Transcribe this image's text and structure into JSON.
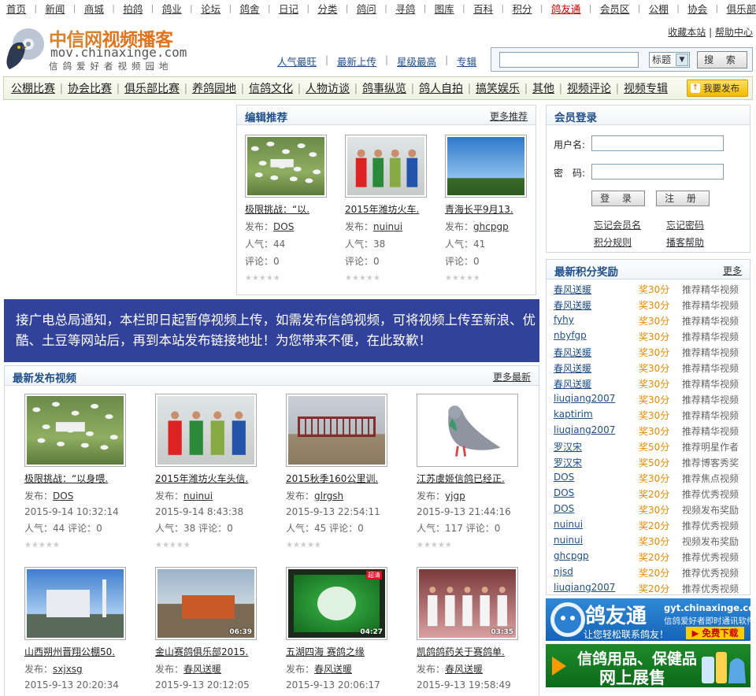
{
  "top_nav": [
    "首页",
    "新闻",
    "商城",
    "拍鸽",
    "鸽业",
    "论坛",
    "鸽舍",
    "日记",
    "分类",
    "鸽问",
    "寻鸽",
    "图库",
    "百科",
    "积分",
    "鸽友通",
    "会员区",
    "公棚",
    "协会",
    "俱乐部"
  ],
  "logo": {
    "title_cn_a": "中信网",
    "title_cn_b": "视频播客",
    "domain": "mov.chinaxinge.com",
    "slogan": "信鸽爱好者视频园地"
  },
  "top_links": {
    "favorite": "收藏本站",
    "help": "帮助中心"
  },
  "header_links": [
    "人气最旺",
    "最新上传",
    "星级最高",
    "专辑"
  ],
  "search": {
    "value": "",
    "select_value": "标题",
    "button": "搜 索"
  },
  "categories": [
    "公棚比赛",
    "协会比赛",
    "俱乐部比赛",
    "养鸽园地",
    "信鸽文化",
    "人物访谈",
    "鸽事纵览",
    "鸽人自拍",
    "搞笑娱乐",
    "其他",
    "视频评论",
    "视频专辑"
  ],
  "publish_button": "我要发布",
  "editor_pick": {
    "title": "编辑推荐",
    "more": "更多推荐",
    "items": [
      {
        "title": "极限挑战：“以.",
        "pub_label": "发布：",
        "user": "DOS",
        "pop_label": "人气：",
        "pop": "44",
        "cmt_label": "评论：",
        "cmt": "0"
      },
      {
        "title": "2015年潍坊火车.",
        "pub_label": "发布：",
        "user": "nuinui",
        "pop_label": "人气：",
        "pop": "38",
        "cmt_label": "评论：",
        "cmt": "0"
      },
      {
        "title": "青海长平9月13.",
        "pub_label": "发布：",
        "user": "ghcpgp",
        "pop_label": "人气：",
        "pop": "41",
        "cmt_label": "评论：",
        "cmt": "0"
      }
    ]
  },
  "notice": "接广电总局通知，本栏即日起暂停视频上传，如需发布信鸽视频，可将视频上传至新浪、优酷、土豆等网站后，再到本站发布链接地址！为您带来不便，在此致歉！",
  "latest": {
    "title": "最新发布视频",
    "more": "更多最新",
    "items": [
      {
        "title": "极限挑战：“以身喂.",
        "user": "DOS",
        "date": "2015-9-14 10:32:14",
        "pop": "44",
        "cmt": "0",
        "dur": ""
      },
      {
        "title": "2015年潍坊火车头信.",
        "user": "nuinui",
        "date": "2015-9-14 8:43:38",
        "pop": "38",
        "cmt": "0",
        "dur": ""
      },
      {
        "title": "2015秋季160公里训.",
        "user": "glrgsh",
        "date": "2015-9-13 22:54:11",
        "pop": "45",
        "cmt": "0",
        "dur": ""
      },
      {
        "title": "江苏虞姬信鸽已经正.",
        "user": "yjgp",
        "date": "2015-9-13 21:44:16",
        "pop": "117",
        "cmt": "0",
        "dur": ""
      },
      {
        "title": "山西朔州晋翔公棚50.",
        "user": "sxjxsg",
        "date": "2015-9-13 20:20:34",
        "dur": ""
      },
      {
        "title": "金山赛鸽俱乐部2015.",
        "user": "春风送暖",
        "date": "2015-9-13 20:12:05",
        "dur": "06:39"
      },
      {
        "title": "五湖四海 赛鸽之缘",
        "user": "春风送暖",
        "date": "2015-9-13 20:06:17",
        "dur": "04:27"
      },
      {
        "title": "凯鸽鸽药关于赛鸽单.",
        "user": "春风送暖",
        "date": "2015-9-13 19:58:49",
        "dur": "03:35"
      }
    ],
    "labels": {
      "pub": "发布：",
      "pop": "人气：",
      "cmt": "评论："
    }
  },
  "login": {
    "title": "会员登录",
    "user_label": "用户名:",
    "pwd_label": "密　码:",
    "login_btn": "登 录",
    "register_btn": "注 册",
    "forgot_name": "忘记会员名",
    "forgot_pwd": "忘记密码",
    "rules": "积分规则",
    "help": "播客帮助"
  },
  "points": {
    "title": "最新积分奖励",
    "more": "更多",
    "rows": [
      {
        "user": "春风送暖",
        "pts": "奖30分",
        "reason": "推荐精华视频"
      },
      {
        "user": "春风送暖",
        "pts": "奖30分",
        "reason": "推荐精华视频"
      },
      {
        "user": "fyhy",
        "pts": "奖30分",
        "reason": "推荐精华视频"
      },
      {
        "user": "nbyfgp",
        "pts": "奖30分",
        "reason": "推荐精华视频"
      },
      {
        "user": "春风送暖",
        "pts": "奖30分",
        "reason": "推荐精华视频"
      },
      {
        "user": "春风送暖",
        "pts": "奖30分",
        "reason": "推荐精华视频"
      },
      {
        "user": "春风送暖",
        "pts": "奖30分",
        "reason": "推荐精华视频"
      },
      {
        "user": "liuqiang2007",
        "pts": "奖30分",
        "reason": "推荐精华视频"
      },
      {
        "user": "kaptirim",
        "pts": "奖30分",
        "reason": "推荐精华视频"
      },
      {
        "user": "liuqiang2007",
        "pts": "奖30分",
        "reason": "推荐精华视频"
      },
      {
        "user": "罗汉宋",
        "pts": "奖50分",
        "reason": "推荐明星作者"
      },
      {
        "user": "罗汉宋",
        "pts": "奖50分",
        "reason": "推荐博客秀奖"
      },
      {
        "user": "DOS",
        "pts": "奖30分",
        "reason": "推荐焦点视频"
      },
      {
        "user": "DOS",
        "pts": "奖20分",
        "reason": "推荐优秀视频"
      },
      {
        "user": "DOS",
        "pts": "奖30分",
        "reason": "视频发布奖励"
      },
      {
        "user": "nuinui",
        "pts": "奖20分",
        "reason": "推荐优秀视频"
      },
      {
        "user": "nuinui",
        "pts": "奖30分",
        "reason": "视频发布奖励"
      },
      {
        "user": "ghcpgp",
        "pts": "奖20分",
        "reason": "推荐优秀视频"
      },
      {
        "user": "njsd",
        "pts": "奖20分",
        "reason": "推荐优秀视频"
      },
      {
        "user": "liuqiang2007",
        "pts": "奖20分",
        "reason": "推荐优秀视频"
      }
    ]
  },
  "ad1": {
    "title": "鸽友通",
    "domain": "gyt.chinaxinge.com",
    "sub": "信鸽爱好者即时通讯软件",
    "slogan": "让您轻松联系鸽友！",
    "cta": "▶ 免费下载"
  },
  "ad2": {
    "title1": "信鸽用品、保健品",
    "title2": "网上展售"
  }
}
